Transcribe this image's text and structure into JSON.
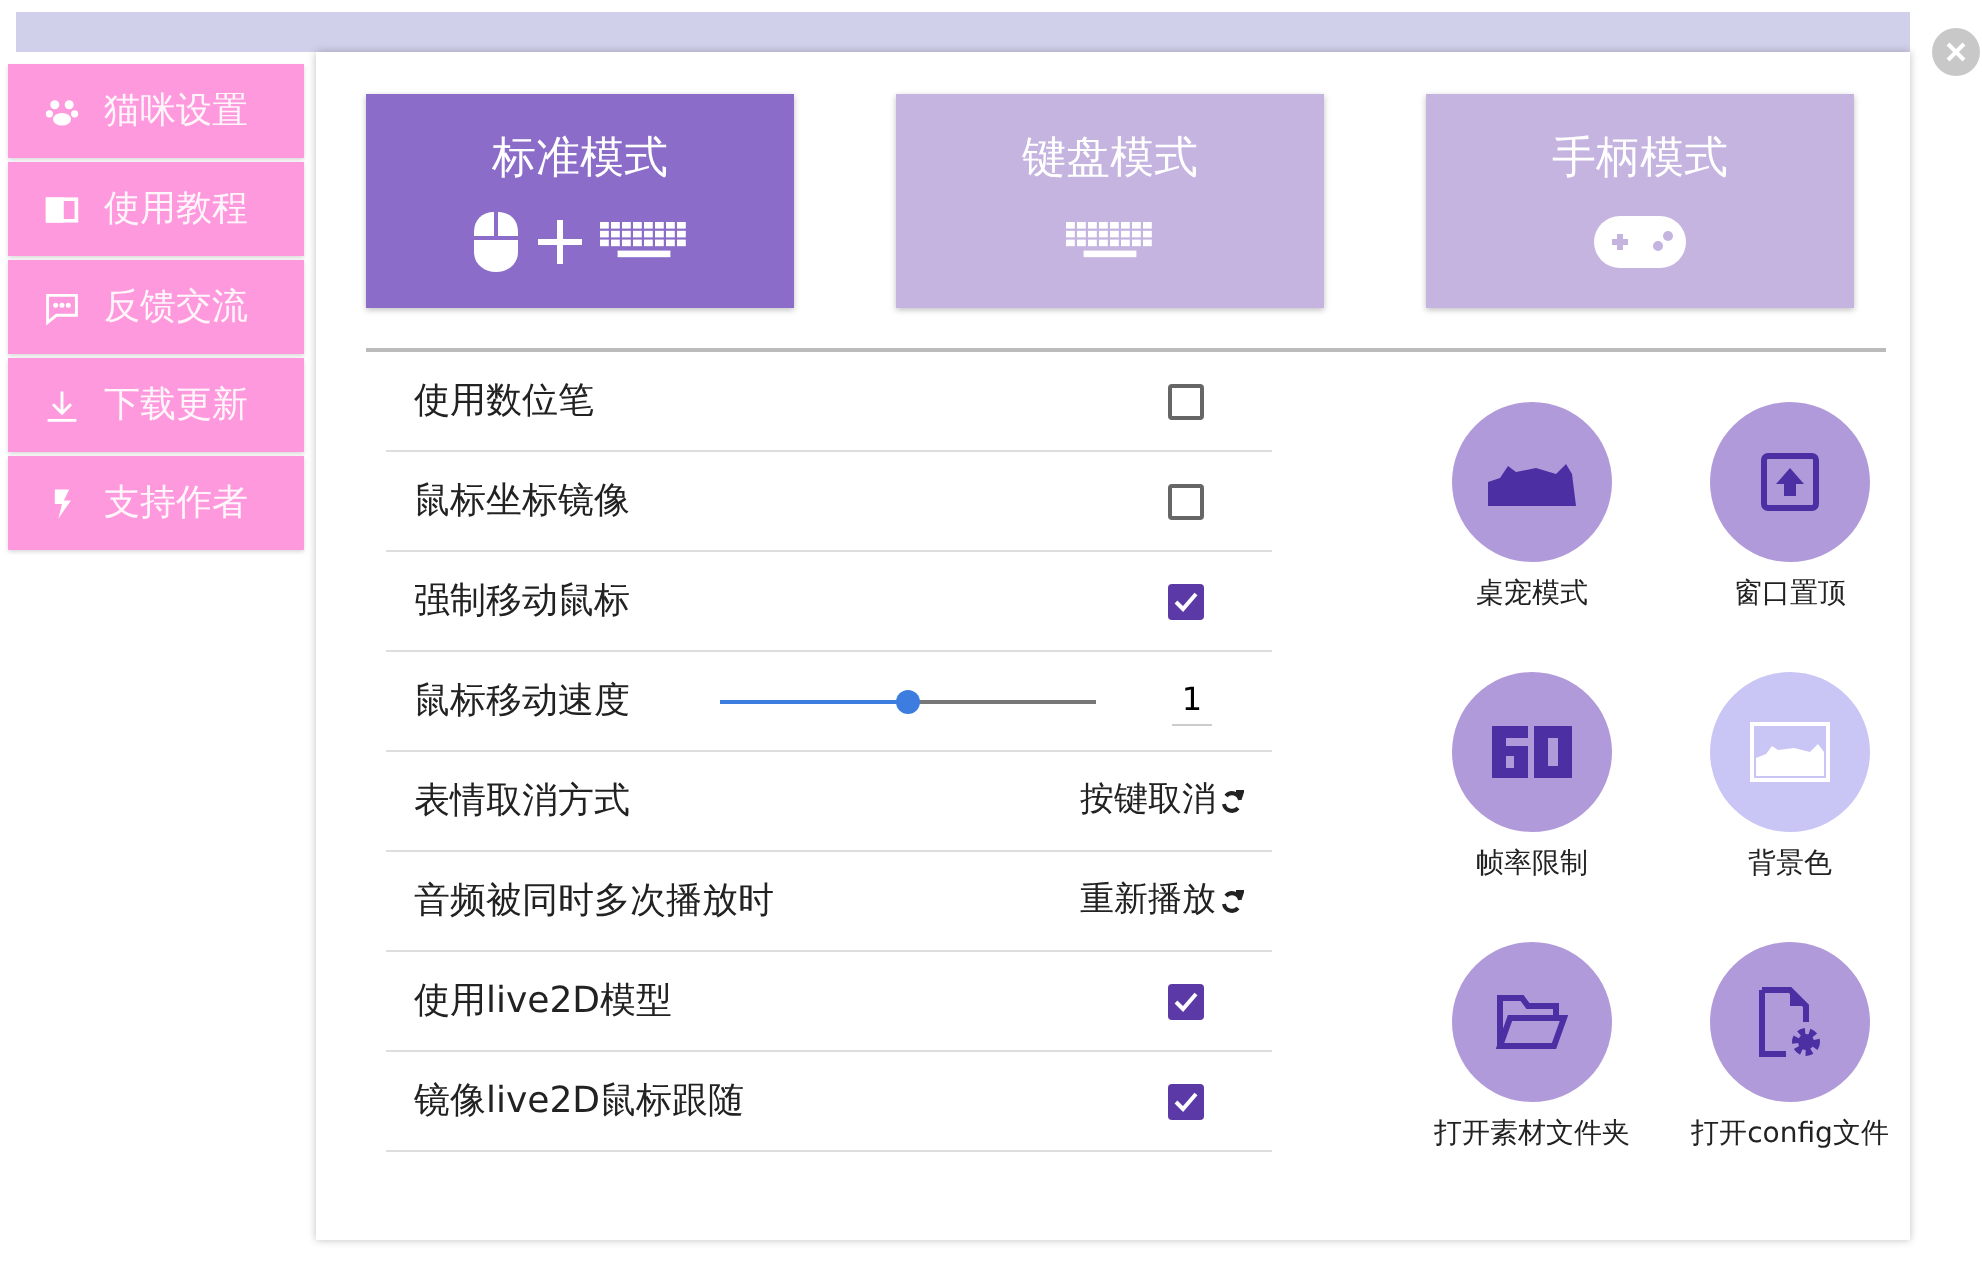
{
  "sidebar": {
    "items": [
      {
        "label": "猫咪设置"
      },
      {
        "label": "使用教程"
      },
      {
        "label": "反馈交流"
      },
      {
        "label": "下载更新"
      },
      {
        "label": "支持作者"
      }
    ]
  },
  "modes": [
    {
      "label": "标准模式",
      "kind": "mouse-keyboard",
      "selected": true
    },
    {
      "label": "键盘模式",
      "kind": "keyboard",
      "selected": false
    },
    {
      "label": "手柄模式",
      "kind": "gamepad",
      "selected": false
    }
  ],
  "settings": [
    {
      "label": "使用数位笔",
      "kind": "checkbox",
      "checked": false
    },
    {
      "label": "鼠标坐标镜像",
      "kind": "checkbox",
      "checked": false
    },
    {
      "label": "强制移动鼠标",
      "kind": "checkbox",
      "checked": true
    },
    {
      "label": "鼠标移动速度",
      "kind": "slider",
      "level": 0.5,
      "value": "1"
    },
    {
      "label": "表情取消方式",
      "kind": "cycle",
      "value": "按键取消"
    },
    {
      "label": "音频被同时多次播放时",
      "kind": "cycle",
      "value": "重新播放"
    },
    {
      "label": "使用live2D模型",
      "kind": "checkbox",
      "checked": true
    },
    {
      "label": "镜像live2D鼠标跟随",
      "kind": "checkbox",
      "checked": true
    }
  ],
  "actions": [
    {
      "label": "桌宠模式",
      "dimmed": false
    },
    {
      "label": "窗口置顶",
      "dimmed": false
    },
    {
      "label": "帧率限制",
      "dimmed": false
    },
    {
      "label": "背景色",
      "dimmed": true
    },
    {
      "label": "打开素材文件夹",
      "dimmed": false
    },
    {
      "label": "打开config文件",
      "dimmed": false
    }
  ]
}
